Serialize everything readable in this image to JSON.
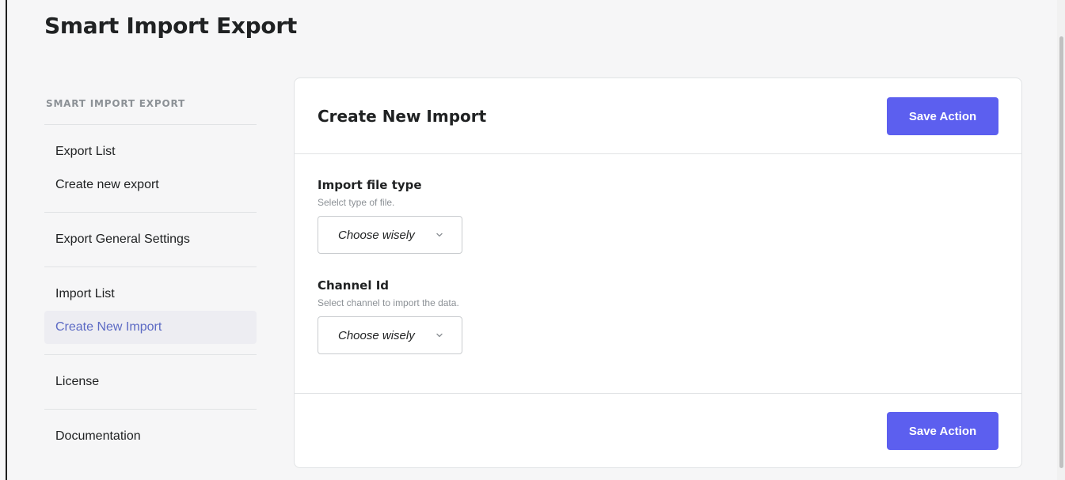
{
  "page": {
    "title": "Smart Import Export"
  },
  "sidebar": {
    "heading": "SMART IMPORT EXPORT",
    "groups": [
      {
        "items": [
          {
            "label": "Export List"
          },
          {
            "label": "Create new export"
          }
        ]
      },
      {
        "items": [
          {
            "label": "Export General Settings"
          }
        ]
      },
      {
        "items": [
          {
            "label": "Import List"
          },
          {
            "label": "Create New Import",
            "active": true
          }
        ]
      },
      {
        "items": [
          {
            "label": "License"
          }
        ]
      },
      {
        "items": [
          {
            "label": "Documentation"
          }
        ]
      }
    ]
  },
  "card": {
    "title": "Create New Import",
    "save_label": "Save Action",
    "footer_save_label": "Save Action",
    "fields": [
      {
        "label": "Import file type",
        "help": "Selelct type of file.",
        "value": "Choose wisely"
      },
      {
        "label": "Channel Id",
        "help": "Select channel to import the data.",
        "value": "Choose wisely"
      }
    ]
  },
  "colors": {
    "accent": "#5c5fef",
    "active_nav_text": "#5c6ac4",
    "active_nav_bg": "#ededf2",
    "background": "#f6f6f7"
  },
  "icons": {
    "dropdown": "chevron-down-icon"
  }
}
